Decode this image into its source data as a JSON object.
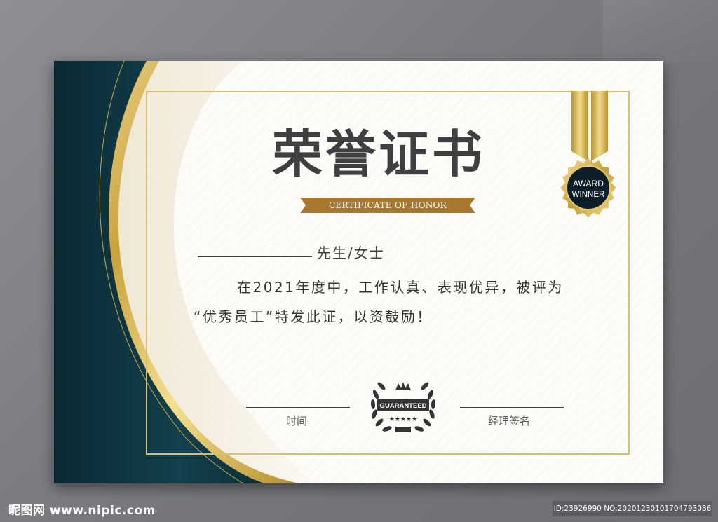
{
  "certificate": {
    "title": "荣誉证书",
    "subtitle_ribbon": "CERTIFICATE OF HONOR",
    "salutation": "先生/女士",
    "body_line1": "在2021年度中，工作认真、表现优异，被评为",
    "body_line2": "“优秀员工”特发此证，以资鼓励！",
    "time_label": "时间",
    "signature_label": "经理签名",
    "badge_line1": "AWARD",
    "badge_line2": "WINNER",
    "seal_text": "GUARANTEED",
    "seal_stars": "★★★★★"
  },
  "watermark": {
    "site": "昵图网 www.nipic.com",
    "id_text": "ID:23926990 NO:20201230101704793086"
  },
  "colors": {
    "navy": "#0f2f3a",
    "gold": "#d4b24c",
    "ribbon_brown": "#a9782f",
    "text_dark": "#3f3f41"
  }
}
